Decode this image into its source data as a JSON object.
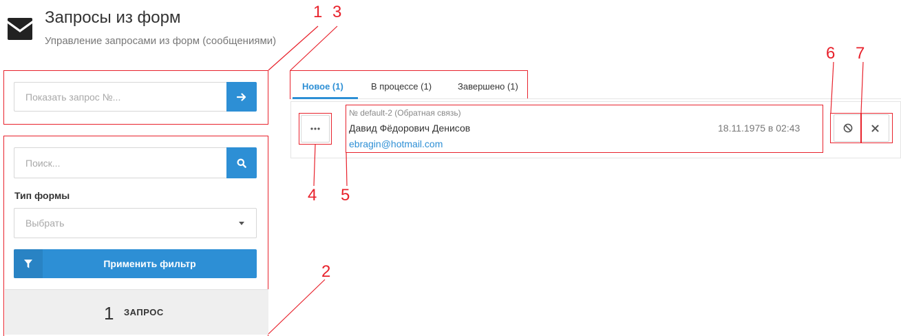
{
  "header": {
    "icon": "envelope-icon",
    "title": "Запросы из форм",
    "subtitle": "Управление запросами из форм (сообщениями)"
  },
  "show_request": {
    "placeholder": "Показать запрос №...",
    "button_icon": "arrow-right-icon"
  },
  "filters": {
    "search_placeholder": "Поиск...",
    "search_icon": "search-icon",
    "form_type_label": "Тип формы",
    "form_type_selected": "Выбрать",
    "apply_icon": "filter-icon",
    "apply_label": "Применить фильтр"
  },
  "summary": {
    "count": "1",
    "label": "ЗАПРОС"
  },
  "tabs": [
    {
      "label": "Новое (1)",
      "active": true
    },
    {
      "label": "В процессе (1)",
      "active": false
    },
    {
      "label": "Завершено (1)",
      "active": false
    }
  ],
  "request": {
    "id_line": "№ default-2 (Обратная связь)",
    "name": "Давид Фёдорович Денисов",
    "email": "ebragin@hotmail.com",
    "datetime": "18.11.1975 в 02:43",
    "more_icon": "ellipsis-icon",
    "reject_icon": "ban-icon",
    "close_icon": "close-icon"
  },
  "annotations": {
    "n1": "1",
    "n2": "2",
    "n3": "3",
    "n4": "4",
    "n5": "5",
    "n6": "6",
    "n7": "7"
  },
  "colors": {
    "accent": "#2d8fd5",
    "annotation": "#e8212b"
  }
}
